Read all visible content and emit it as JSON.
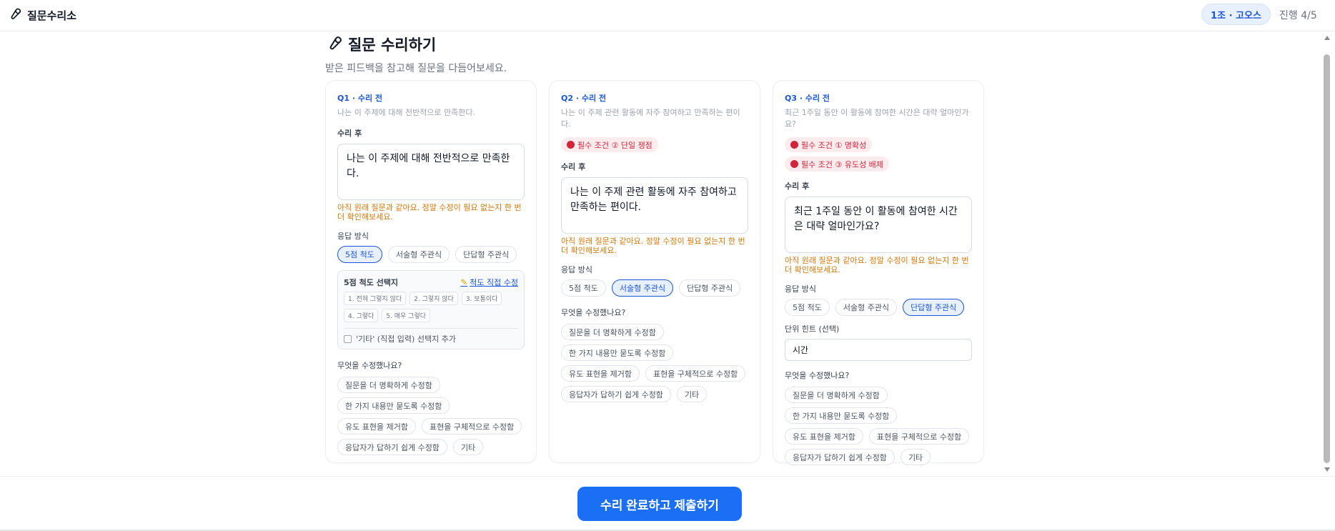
{
  "app": {
    "title": "질문수리소",
    "icon": "wrench-icon"
  },
  "header": {
    "team": "1조 · 고오스",
    "progress": "진행 4/5"
  },
  "page": {
    "title": "질문 수리하기",
    "subtitle": "받은 피드백을 참고해 질문을 다듬어보세요."
  },
  "labels": {
    "after": "수리 후",
    "warning": "아직 원래 질문과 같아요. 정말 수정이 필요 없는지 한 번 더 확인해보세요.",
    "response_type": "응답 방식",
    "what_changed": "무엇을 수정했나요?",
    "scale_title": "5점 척도 선택지",
    "scale_edit": "척도 직접 수정",
    "other_option": "'기타' (직접 입력) 선택지 추가",
    "unit_hint": "단위 힌트 (선택)"
  },
  "response_types": [
    "5점 척도",
    "서술형 주관식",
    "단답형 주관식"
  ],
  "scale_options": [
    "1. 전혀 그렇지 않다",
    "2. 그렇지 않다",
    "3. 보통이다",
    "4. 그렇다",
    "5. 매우 그렇다"
  ],
  "change_reasons": [
    "질문을 더 명확하게 수정함",
    "한 가지 내용만 묻도록 수정함",
    "유도 표현을 제거함",
    "표현을 구체적으로 수정함",
    "응답자가 답하기 쉽게 수정함",
    "기타"
  ],
  "questions": [
    {
      "label": "Q1 · 수리 전",
      "original": "나는 이 주제에 대해 전반적으로 만족한다.",
      "issues": [],
      "revised": "나는 이 주제에 대해 전반적으로 만족한다.",
      "selected_type": "5점 척도"
    },
    {
      "label": "Q2 · 수리 전",
      "original": "나는 이 주제 관련 활동에 자주 참여하고 만족하는 편이다.",
      "issues": [
        "필수 조건 ② 단일 쟁점"
      ],
      "revised": "나는 이 주제 관련 활동에 자주 참여하고 만족하는 편이다.",
      "selected_type": "서술형 주관식"
    },
    {
      "label": "Q3 · 수리 전",
      "original": "최근 1주일 동안 이 활동에 참여한 시간은 대략 얼마인가요?",
      "issues": [
        "필수 조건 ① 명확성",
        "필수 조건 ③ 유도성 배제"
      ],
      "revised": "최근 1주일 동안 이 활동에 참여한 시간은 대략 얼마인가요?",
      "selected_type": "단답형 주관식",
      "unit_value": "시간"
    }
  ],
  "submit_label": "수리 완료하고 제출하기",
  "colors": {
    "accent": "#1a56db",
    "button": "#1a6ff5",
    "warning": "#d97706",
    "issue": "#d4243b"
  }
}
